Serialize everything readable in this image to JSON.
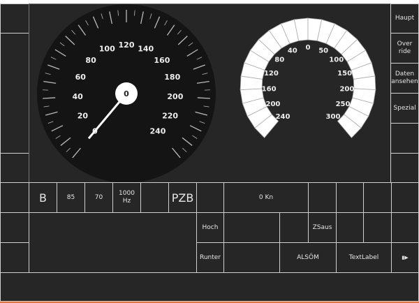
{
  "left_column": [
    "",
    "",
    ""
  ],
  "right_menu": [
    {
      "label": "Haupt"
    },
    {
      "label": "Over\nride"
    },
    {
      "label": "Daten\nansehen"
    },
    {
      "label": "Spezial"
    },
    {
      "label": ""
    },
    {
      "label": ""
    }
  ],
  "speedometer": {
    "min": 0,
    "max": 240,
    "label_step": 20,
    "minor_step": 5,
    "labels": [
      "0",
      "20",
      "40",
      "60",
      "80",
      "100",
      "120",
      "140",
      "160",
      "180",
      "200",
      "220",
      "240"
    ],
    "current_speed": 0,
    "center_readout": "0",
    "colors": {
      "dial": "#141414",
      "needle": "#ffffff"
    }
  },
  "ring_gauge": {
    "left_labels": [
      "0",
      "40",
      "80",
      "120",
      "160",
      "200",
      "240"
    ],
    "right_labels": [
      "50",
      "100",
      "150",
      "200",
      "250",
      "300"
    ],
    "segments": 24
  },
  "row1": {
    "b": "B",
    "v85": "85",
    "v70": "70",
    "hz1": "1000",
    "hz2": "Hz",
    "pzb": "PZB",
    "kn": "0 Kn"
  },
  "row2": {
    "hoch": "Hoch",
    "zsaus": "ZSaus"
  },
  "row3": {
    "runter": "Runter",
    "alsom": "ALSÖM",
    "textlabel": "TextLabel",
    "icon": "play-icon"
  }
}
